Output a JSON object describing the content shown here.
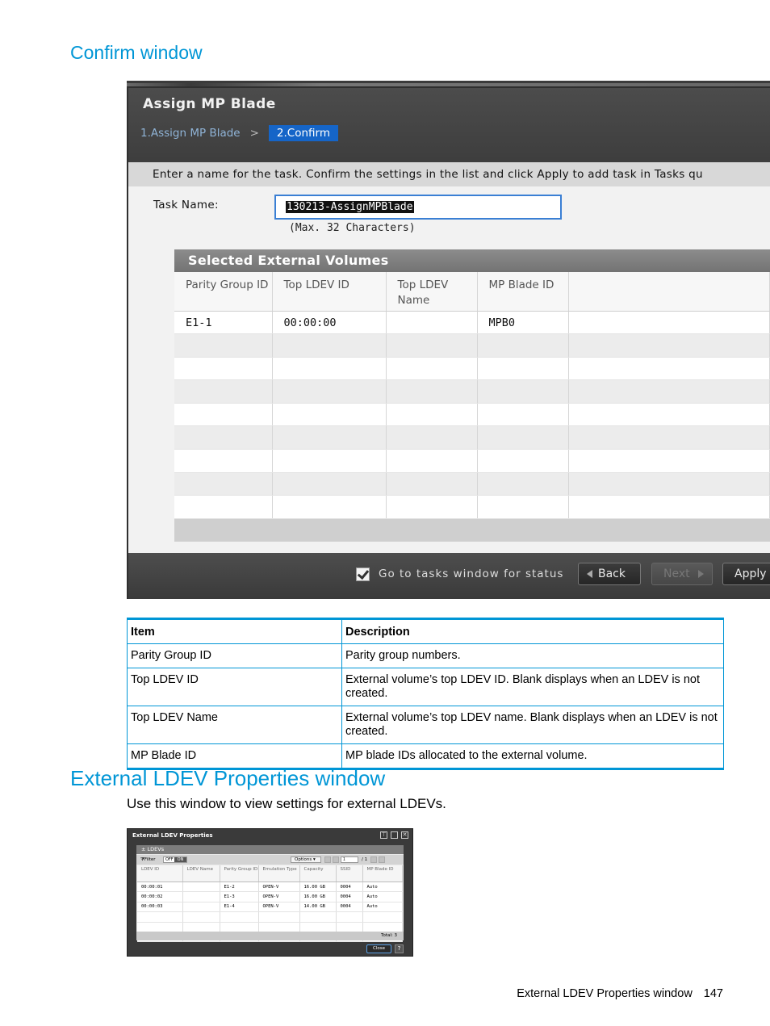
{
  "confirm_heading": "Confirm window",
  "dialog": {
    "title": "Assign MP Blade",
    "steps": [
      "1.Assign MP Blade",
      "2.Confirm"
    ],
    "step_separator": ">",
    "instruction": "Enter a name for the task. Confirm the settings in the list and click Apply to add task in Tasks qu",
    "task_name_label": "Task Name:",
    "task_name_value": "130213-AssignMPBlade",
    "max_chars": "(Max. 32 Characters)",
    "table_title": "Selected External Volumes",
    "columns": [
      "Parity Group ID",
      "Top LDEV ID",
      "Top LDEV Name",
      "MP Blade ID"
    ],
    "row": {
      "parity_group_id": "E1-1",
      "top_ldev_id": "00:00:00",
      "top_ldev_name": "",
      "mp_blade_id": "MPB0"
    },
    "checkbox_label": "Go to tasks window for status",
    "checkbox_checked": true,
    "back_label": "Back",
    "next_label": "Next",
    "apply_label": "Apply"
  },
  "desc_table": {
    "headers": [
      "Item",
      "Description"
    ],
    "rows": [
      {
        "item": "Parity Group ID",
        "description": "Parity group numbers."
      },
      {
        "item": "Top LDEV ID",
        "description": "External volume’s top LDEV ID. Blank displays when an LDEV is not created."
      },
      {
        "item": "Top LDEV Name",
        "description": "External volume’s top LDEV name. Blank displays when an LDEV is not created."
      },
      {
        "item": "MP Blade ID",
        "description": "MP blade IDs allocated to the external volume."
      }
    ]
  },
  "ext_heading": "External LDEV Properties window",
  "ext_intro": "Use this window to view settings for external LDEVs.",
  "ext_window": {
    "title": "External LDEV Properties",
    "panel_title": "LDEVs",
    "filter_label": "Filter",
    "filter_state_off": "OFF",
    "filter_state_on": "ON",
    "options_label": "Options",
    "page_value": "1",
    "page_total": "/ 1",
    "columns": [
      "LDEV ID",
      "LDEV Name",
      "Parity Group ID",
      "Emulation Type",
      "Capacity",
      "SSID",
      "MP Blade ID"
    ],
    "rows": [
      [
        "00:00:01",
        "",
        "E1-2",
        "OPEN-V",
        "16.00 GB",
        "0004",
        "Auto"
      ],
      [
        "00:00:02",
        "",
        "E1-3",
        "OPEN-V",
        "16.00 GB",
        "0004",
        "Auto"
      ],
      [
        "00:00:03",
        "",
        "E1-4",
        "OPEN-V",
        "14.00 GB",
        "0004",
        "Auto"
      ]
    ],
    "total": "Total: 3",
    "close_label": "Close",
    "help_label": "?"
  },
  "footer": {
    "section": "External LDEV Properties window",
    "page": "147"
  },
  "colors": {
    "accent": "#0096d6",
    "active_step": "#1565c8"
  }
}
